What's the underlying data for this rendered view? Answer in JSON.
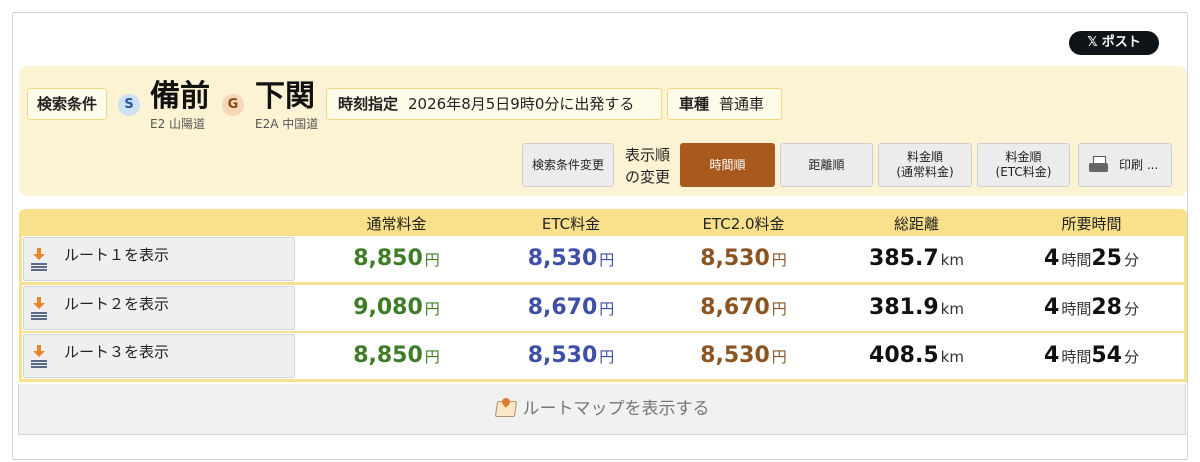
{
  "share": {
    "label": "ポスト",
    "logo": "𝕏"
  },
  "conditions": {
    "label": "検索条件",
    "start": {
      "badge": "S",
      "name": "備前",
      "road": "E2 山陽道"
    },
    "goal": {
      "badge": "G",
      "name": "下関",
      "road": "E2A 中国道"
    },
    "time": {
      "label": "時刻指定",
      "value": "2026年8月5日9時0分に出発する"
    },
    "vehicle": {
      "label": "車種",
      "value": "普通車"
    }
  },
  "controls": {
    "change_conditions": "検索条件変更",
    "sort_label_line1": "表示順",
    "sort_label_line2": "の変更",
    "sort_time": "時間順",
    "sort_distance": "距離順",
    "sort_fee_normal_1": "料金順",
    "sort_fee_normal_2": "(通常料金)",
    "sort_fee_etc_1": "料金順",
    "sort_fee_etc_2": "(ETC料金)",
    "print": "印刷 ..."
  },
  "table": {
    "headers": [
      "通常料金",
      "ETC料金",
      "ETC2.0料金",
      "総距離",
      "所要時間"
    ],
    "yen": "円",
    "km": "km",
    "hour_unit": "時間",
    "minute_unit": "分",
    "rows": [
      {
        "label": "ルート１を表示",
        "normal": "8,850",
        "etc": "8,530",
        "etc2": "8,530",
        "distance": "385.7",
        "hours": "4",
        "minutes": "25"
      },
      {
        "label": "ルート２を表示",
        "normal": "9,080",
        "etc": "8,670",
        "etc2": "8,670",
        "distance": "381.9",
        "hours": "4",
        "minutes": "28"
      },
      {
        "label": "ルート３を表示",
        "normal": "8,850",
        "etc": "8,530",
        "etc2": "8,530",
        "distance": "408.5",
        "hours": "4",
        "minutes": "54"
      }
    ]
  },
  "map": {
    "label": "ルートマップを表示する"
  },
  "colors": {
    "panel_bg": "#fcf3d4",
    "table_header_bg": "#f9e08a",
    "active_sort": "#a8591e",
    "normal_fee": "#3e7d26",
    "etc_fee": "#3f4fa8",
    "etc2_fee": "#8b5522"
  }
}
